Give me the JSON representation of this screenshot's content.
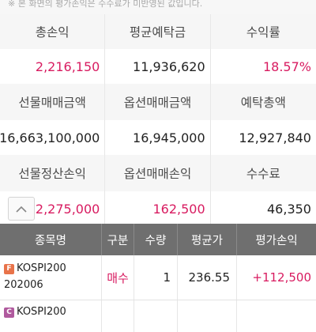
{
  "notice": "※ 본 화면의 평가손익은 수수료가 미반영된 값입니다.",
  "summary": {
    "row1": {
      "labels": [
        "총손익",
        "평균예탁금",
        "수익률"
      ],
      "values": [
        "2,216,150",
        "11,936,620",
        "18.57%"
      ]
    },
    "row2": {
      "labels": [
        "선물매매금액",
        "옵션매매금액",
        "예탁총액"
      ],
      "values": [
        "16,663,100,000",
        "16,945,000",
        "12,927,840"
      ]
    },
    "row3": {
      "labels": [
        "선물정산손익",
        "옵션매매손익",
        "수수료"
      ],
      "values": [
        "2,275,000",
        "162,500",
        "46,350"
      ]
    }
  },
  "collapse_icon": "chevron-up-icon",
  "table": {
    "headers": [
      "종목명",
      "구분",
      "수량",
      "평균가",
      "평가손익"
    ],
    "rows": [
      {
        "badge": "F",
        "name": "KOSPI200",
        "expiry": "202006",
        "side": "매수",
        "qty": "1",
        "avg": "236.55",
        "pnl": "+112,500"
      },
      {
        "badge": "C",
        "name": "KOSPI200",
        "expiry": "",
        "side": "",
        "qty": "",
        "avg": "",
        "pnl": ""
      }
    ]
  },
  "colors": {
    "profit": "#d81b60",
    "header_bg": "#6f6f6f",
    "label_bg": "#f6f6f6",
    "badge_futures": "#e8734a",
    "badge_call": "#b05a9e"
  }
}
